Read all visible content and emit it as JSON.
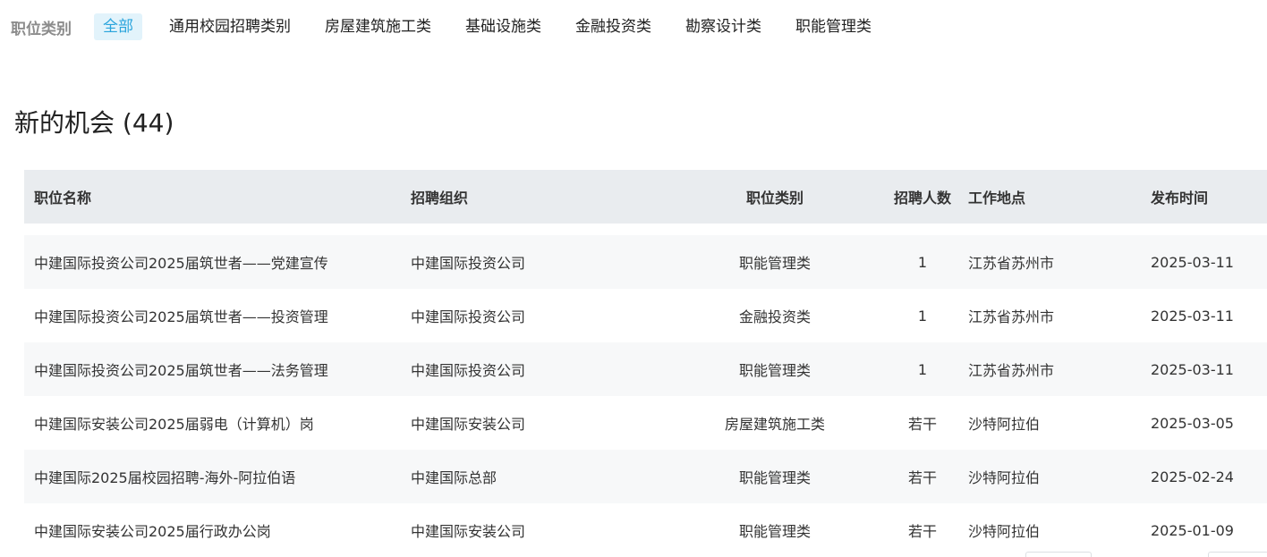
{
  "filter": {
    "label": "职位类别",
    "tabs": [
      {
        "label": "全部",
        "active": true
      },
      {
        "label": "通用校园招聘类别",
        "active": false
      },
      {
        "label": "房屋建筑施工类",
        "active": false
      },
      {
        "label": "基础设施类",
        "active": false
      },
      {
        "label": "金融投资类",
        "active": false
      },
      {
        "label": "勘察设计类",
        "active": false
      },
      {
        "label": "职能管理类",
        "active": false
      }
    ]
  },
  "section": {
    "title": "新的机会 (44)"
  },
  "table": {
    "headers": {
      "name": "职位名称",
      "org": "招聘组织",
      "category": "职位类别",
      "count": "招聘人数",
      "location": "工作地点",
      "date": "发布时间"
    },
    "rows": [
      {
        "name": "中建国际投资公司2025届筑世者——党建宣传",
        "org": "中建国际投资公司",
        "category": "职能管理类",
        "count": "1",
        "location": "江苏省苏州市",
        "date": "2025-03-11"
      },
      {
        "name": "中建国际投资公司2025届筑世者——投资管理",
        "org": "中建国际投资公司",
        "category": "金融投资类",
        "count": "1",
        "location": "江苏省苏州市",
        "date": "2025-03-11"
      },
      {
        "name": "中建国际投资公司2025届筑世者——法务管理",
        "org": "中建国际投资公司",
        "category": "职能管理类",
        "count": "1",
        "location": "江苏省苏州市",
        "date": "2025-03-11"
      },
      {
        "name": "中建国际安装公司2025届弱电（计算机）岗",
        "org": "中建国际安装公司",
        "category": "房屋建筑施工类",
        "count": "若干",
        "location": "沙特阿拉伯",
        "date": "2025-03-05"
      },
      {
        "name": "中建国际2025届校园招聘-海外-阿拉伯语",
        "org": "中建国际总部",
        "category": "职能管理类",
        "count": "若干",
        "location": "沙特阿拉伯",
        "date": "2025-02-24"
      },
      {
        "name": "中建国际安装公司2025届行政办公岗",
        "org": "中建国际安装公司",
        "category": "职能管理类",
        "count": "若干",
        "location": "沙特阿拉伯",
        "date": "2025-01-09"
      }
    ]
  }
}
